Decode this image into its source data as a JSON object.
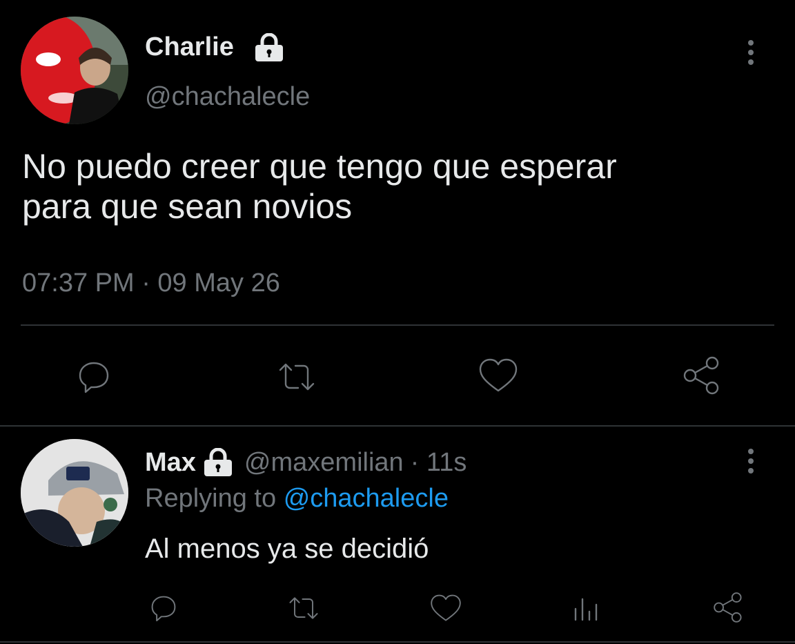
{
  "main_tweet": {
    "author_name": "Charlie",
    "author_handle": "@chachalecle",
    "text_line1": "No puedo creer que tengo que esperar",
    "text_line2": "para que sean novios",
    "timestamp": "07:37 PM · 09 May 26",
    "protected_icon": "lock-icon",
    "more_icon": "more-vertical-icon"
  },
  "reply": {
    "author_name": "Max",
    "author_handle": "@maxemilian",
    "time": "· 11s",
    "replying_prefix": "Replying to",
    "replying_to": "@chachalecle",
    "text": "Al menos ya se decidió",
    "protected_icon": "lock-icon",
    "more_icon": "more-vertical-icon"
  },
  "actions": [
    "reply-icon",
    "retweet-icon",
    "like-icon",
    "share-icon"
  ],
  "reply_actions": [
    "reply-icon",
    "retweet-icon",
    "like-icon",
    "analytics-icon",
    "share-icon"
  ],
  "colors": {
    "background": "#000000",
    "text": "#e7e9ea",
    "muted": "#71767b",
    "link": "#1d9bf0",
    "divider": "#2f3336"
  }
}
